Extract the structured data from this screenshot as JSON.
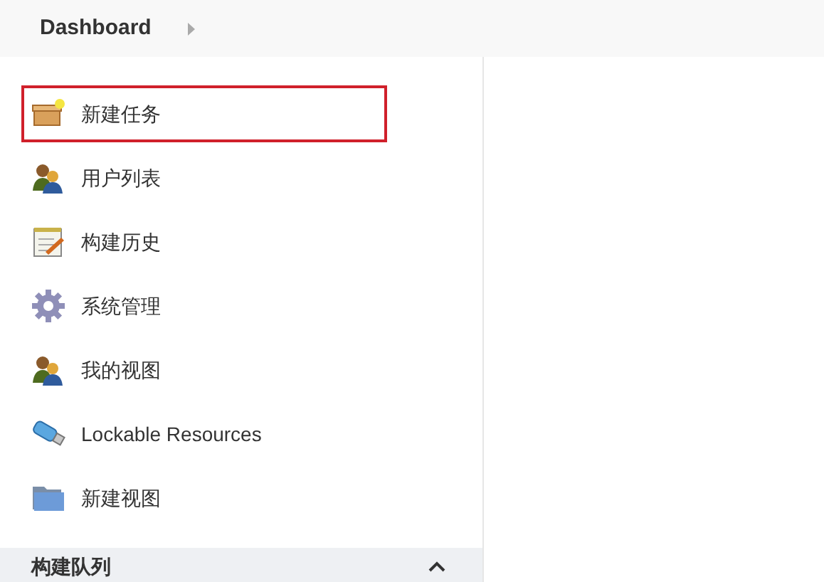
{
  "breadcrumb": {
    "title": "Dashboard"
  },
  "sidebar": {
    "items": [
      {
        "kind": "new-item",
        "label": "新建任务",
        "highlighted": true
      },
      {
        "kind": "people",
        "label": "用户列表",
        "highlighted": false
      },
      {
        "kind": "history",
        "label": "构建历史",
        "highlighted": false
      },
      {
        "kind": "gear",
        "label": "系统管理",
        "highlighted": false
      },
      {
        "kind": "people",
        "label": "我的视图",
        "highlighted": false
      },
      {
        "kind": "usb",
        "label": "Lockable Resources",
        "highlighted": false
      },
      {
        "kind": "folder",
        "label": "新建视图",
        "highlighted": false
      }
    ]
  },
  "build_queue": {
    "title": "构建队列",
    "expanded": true
  }
}
